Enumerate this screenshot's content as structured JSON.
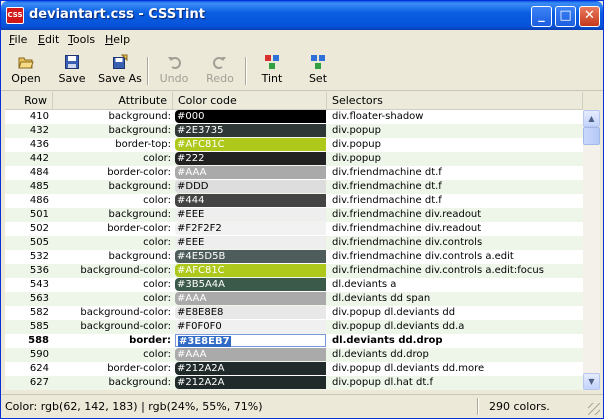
{
  "window": {
    "title": "deviantart.css - CSSTint",
    "app_icon_text": "CSS",
    "minimize": "_",
    "maximize": "□",
    "close": "✕"
  },
  "menu": [
    {
      "label": "File",
      "accel": "F",
      "rest": "ile"
    },
    {
      "label": "Edit",
      "accel": "E",
      "rest": "dit"
    },
    {
      "label": "Tools",
      "accel": "T",
      "rest": "ools"
    },
    {
      "label": "Help",
      "accel": "H",
      "rest": "elp"
    }
  ],
  "toolbar": {
    "open": "Open",
    "save": "Save",
    "save_as": "Save As",
    "undo": "Undo",
    "redo": "Redo",
    "tint": "Tint",
    "set": "Set"
  },
  "columns": {
    "row": "Row",
    "attribute": "Attribute",
    "color_code": "Color code",
    "selectors": "Selectors"
  },
  "rows": [
    {
      "row": "410",
      "attr": "background:",
      "code": "#000",
      "bg": "#000000",
      "fg": "#ffffff",
      "sel": "div.floater-shadow"
    },
    {
      "row": "432",
      "attr": "background:",
      "code": "#2E3735",
      "bg": "#2e3735",
      "fg": "#ffffff",
      "sel": "div.popup"
    },
    {
      "row": "436",
      "attr": "border-top:",
      "code": "#AFC81C",
      "bg": "#afc81c",
      "fg": "#ffffff",
      "sel": "div.popup"
    },
    {
      "row": "442",
      "attr": "color:",
      "code": "#222",
      "bg": "#222222",
      "fg": "#ffffff",
      "sel": "div.popup"
    },
    {
      "row": "484",
      "attr": "border-color:",
      "code": "#AAA",
      "bg": "#aaaaaa",
      "fg": "#ffffff",
      "sel": "div.friendmachine dt.f"
    },
    {
      "row": "485",
      "attr": "background:",
      "code": "#DDD",
      "bg": "#dddddd",
      "fg": "#000000",
      "sel": "div.friendmachine dt.f"
    },
    {
      "row": "486",
      "attr": "color:",
      "code": "#444",
      "bg": "#444444",
      "fg": "#ffffff",
      "sel": "div.friendmachine dt.f"
    },
    {
      "row": "501",
      "attr": "background:",
      "code": "#EEE",
      "bg": "#eeeeee",
      "fg": "#000000",
      "sel": "div.friendmachine div.readout"
    },
    {
      "row": "502",
      "attr": "border-color:",
      "code": "#F2F2F2",
      "bg": "#f2f2f2",
      "fg": "#000000",
      "sel": "div.friendmachine div.readout"
    },
    {
      "row": "505",
      "attr": "color:",
      "code": "#EEE",
      "bg": "#eeeeee",
      "fg": "#000000",
      "sel": "div.friendmachine div.controls"
    },
    {
      "row": "532",
      "attr": "background:",
      "code": "#4E5D5B",
      "bg": "#4e5d5b",
      "fg": "#ffffff",
      "sel": "div.friendmachine div.controls a.edit"
    },
    {
      "row": "536",
      "attr": "background-color:",
      "code": "#AFC81C",
      "bg": "#afc81c",
      "fg": "#ffffff",
      "sel": "div.friendmachine div.controls a.edit:focus"
    },
    {
      "row": "543",
      "attr": "color:",
      "code": "#3B5A4A",
      "bg": "#3b5a4a",
      "fg": "#ffffff",
      "sel": "dl.deviants a"
    },
    {
      "row": "563",
      "attr": "color:",
      "code": "#AAA",
      "bg": "#aaaaaa",
      "fg": "#ffffff",
      "sel": "dl.deviants dd span"
    },
    {
      "row": "582",
      "attr": "background-color:",
      "code": "#E8E8E8",
      "bg": "#e8e8e8",
      "fg": "#000000",
      "sel": "div.popup dl.deviants dd"
    },
    {
      "row": "585",
      "attr": "background-color:",
      "code": "#F0F0F0",
      "bg": "#f0f0f0",
      "fg": "#000000",
      "sel": "div.popup dl.deviants dd.a"
    },
    {
      "row": "588",
      "attr": "border:",
      "code": "#3E8EB7",
      "bg": "#ffffff",
      "fg": "#000000",
      "sel": "dl.deviants dd.drop",
      "selected": true
    },
    {
      "row": "590",
      "attr": "color:",
      "code": "#AAA",
      "bg": "#aaaaaa",
      "fg": "#ffffff",
      "sel": "dl.deviants dd.drop"
    },
    {
      "row": "624",
      "attr": "border-color:",
      "code": "#212A2A",
      "bg": "#212a2a",
      "fg": "#ffffff",
      "sel": "div.popup dl.deviants dd.more"
    },
    {
      "row": "627",
      "attr": "background:",
      "code": "#212A2A",
      "bg": "#212a2a",
      "fg": "#ffffff",
      "sel": "div.popup dl.hat dt.f"
    }
  ],
  "status": {
    "color_info": "Color: rgb(62, 142, 183) | rgb(24%, 55%, 71%)",
    "count": "290 colors."
  },
  "colors": {
    "title_bar": "#0652d8",
    "selection": "#316ac5",
    "row_tint": "#eef6e9"
  }
}
